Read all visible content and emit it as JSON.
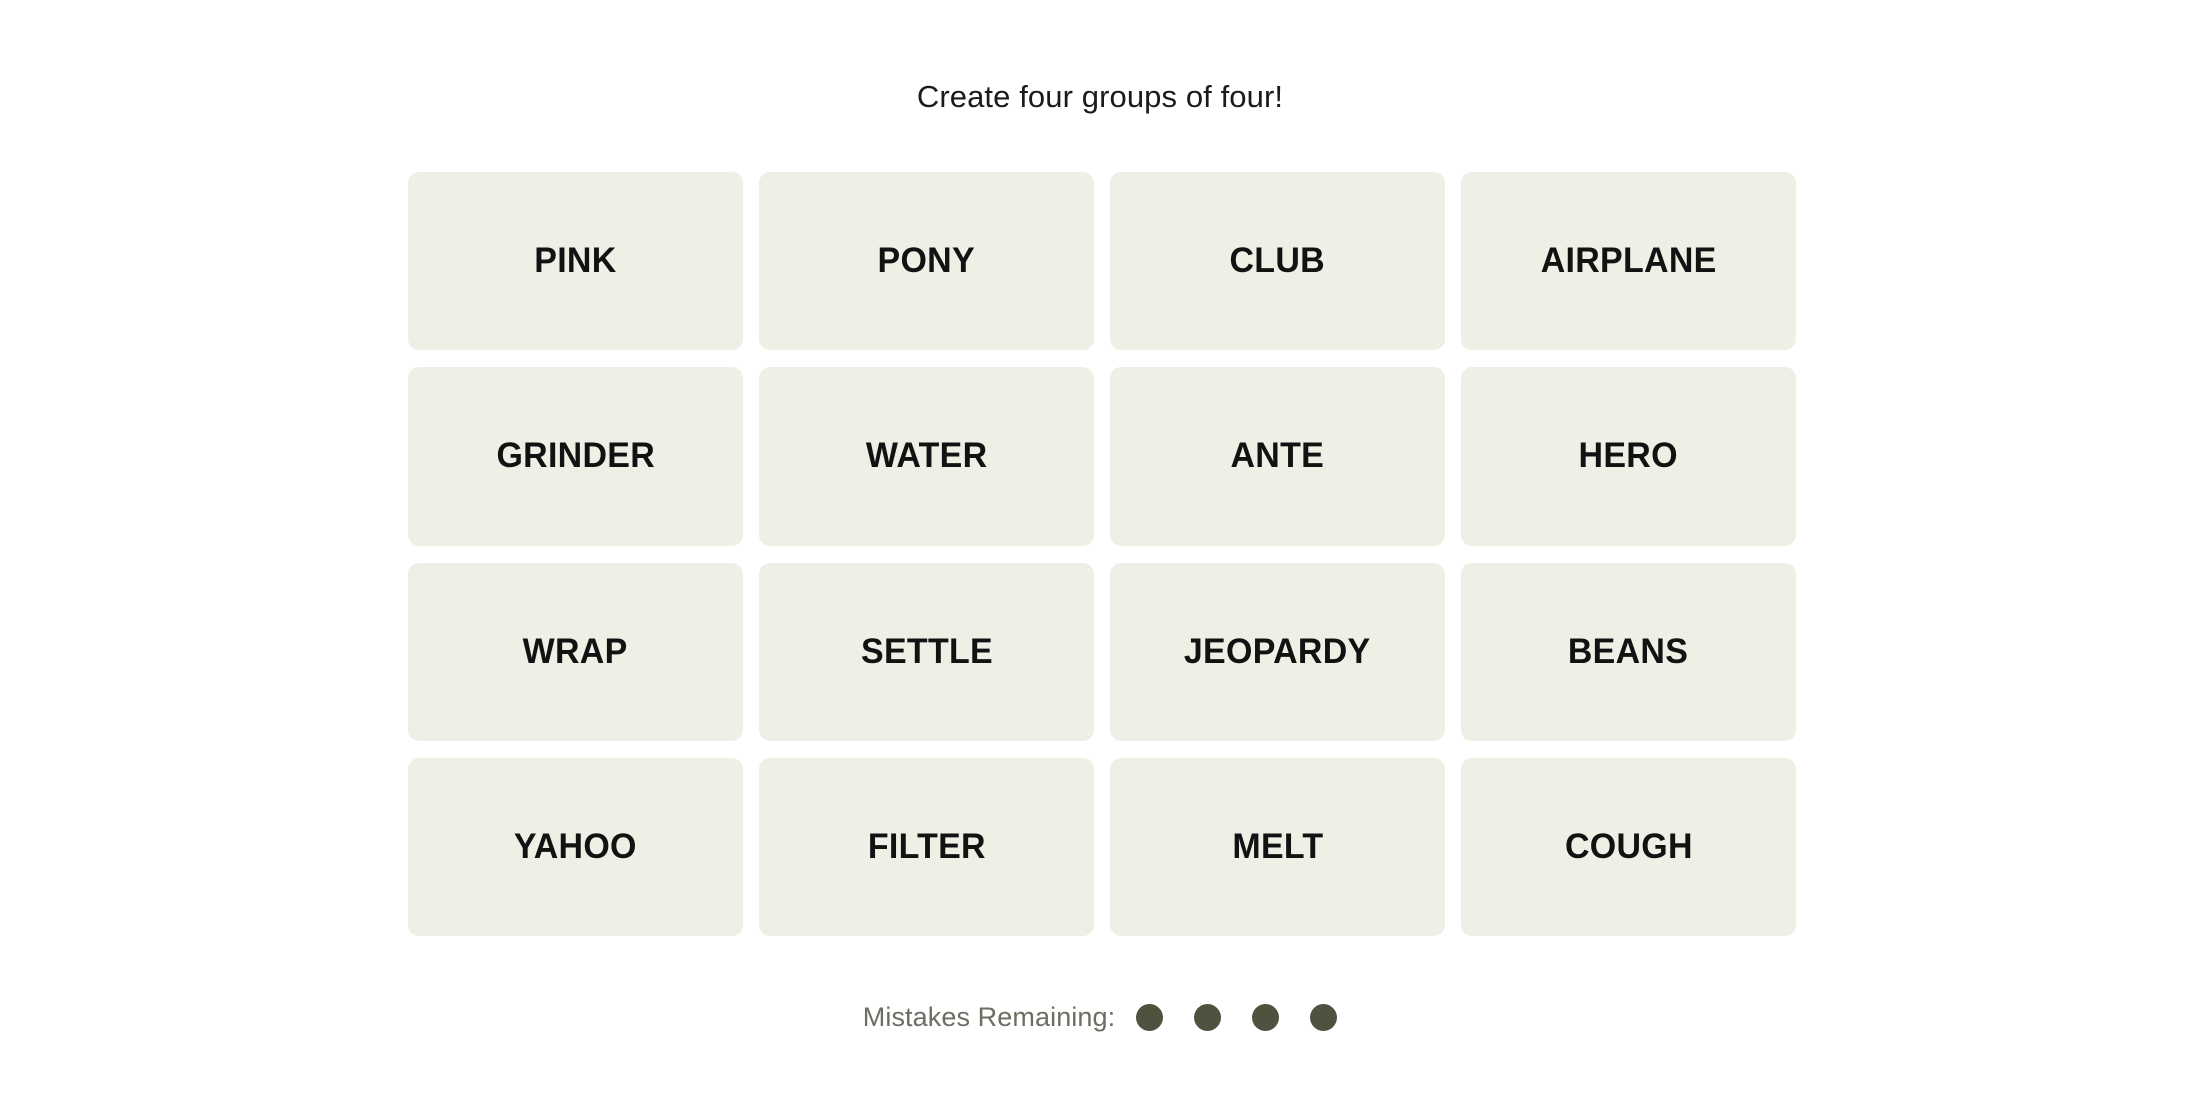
{
  "page": {
    "background_color": "#ffffff",
    "title": "Create four groups of four!"
  },
  "instructions": {
    "text": "Create four groups of four!",
    "color": "#1b1b1b"
  },
  "board": {
    "rows": 4,
    "columns": 4,
    "tile_background_color": "#efefe6",
    "tile_text_color": "#121212",
    "tiles": [
      {
        "label": "PINK",
        "row": 1,
        "column": 1,
        "selected": false
      },
      {
        "label": "PONY",
        "row": 1,
        "column": 2,
        "selected": false
      },
      {
        "label": "CLUB",
        "row": 1,
        "column": 3,
        "selected": false
      },
      {
        "label": "AIRPLANE",
        "row": 1,
        "column": 4,
        "selected": false
      },
      {
        "label": "GRINDER",
        "row": 2,
        "column": 1,
        "selected": false
      },
      {
        "label": "WATER",
        "row": 2,
        "column": 2,
        "selected": false
      },
      {
        "label": "ANTE",
        "row": 2,
        "column": 3,
        "selected": false
      },
      {
        "label": "HERO",
        "row": 2,
        "column": 4,
        "selected": false
      },
      {
        "label": "WRAP",
        "row": 3,
        "column": 1,
        "selected": false
      },
      {
        "label": "SETTLE",
        "row": 3,
        "column": 2,
        "selected": false
      },
      {
        "label": "JEOPARDY",
        "row": 3,
        "column": 3,
        "selected": false
      },
      {
        "label": "BEANS",
        "row": 3,
        "column": 4,
        "selected": false
      },
      {
        "label": "YAHOO",
        "row": 4,
        "column": 1,
        "selected": false
      },
      {
        "label": "FILTER",
        "row": 4,
        "column": 2,
        "selected": false
      },
      {
        "label": "MELT",
        "row": 4,
        "column": 3,
        "selected": false
      },
      {
        "label": "COUGH",
        "row": 4,
        "column": 4,
        "selected": false
      }
    ]
  },
  "mistakes": {
    "label": "Mistakes Remaining:",
    "label_color": "#6d6d64",
    "remaining": 4,
    "dot_color": "#51513f",
    "dots": [
      {
        "state": "filled"
      },
      {
        "state": "filled"
      },
      {
        "state": "filled"
      },
      {
        "state": "filled"
      }
    ]
  }
}
